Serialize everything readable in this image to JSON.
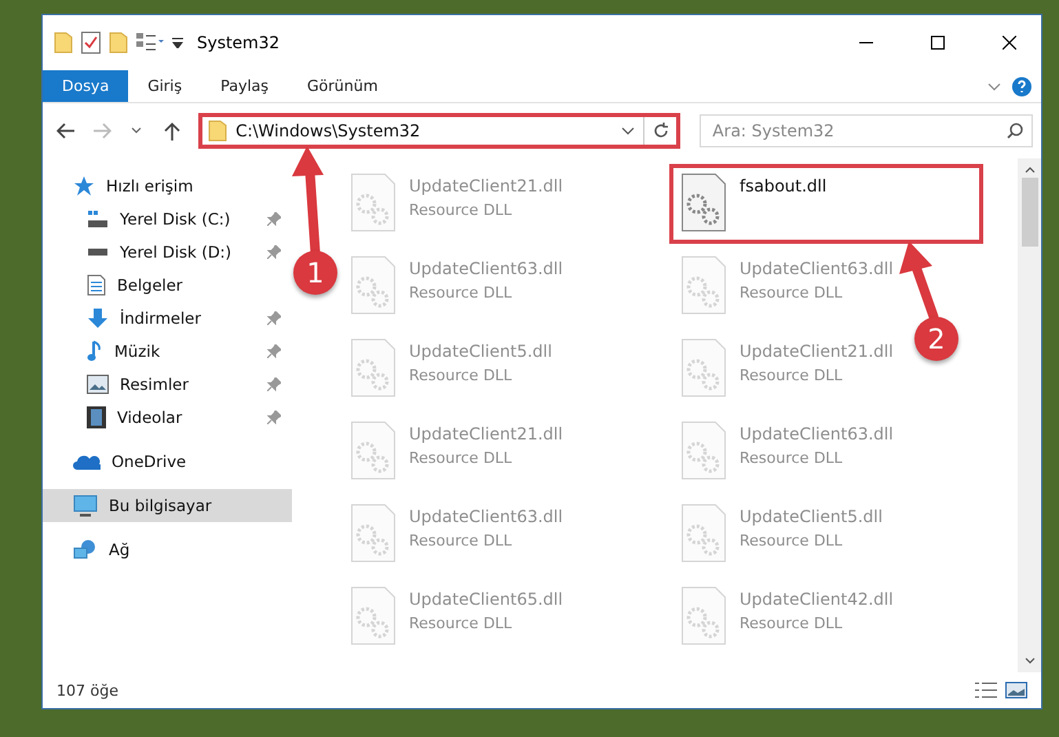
{
  "window": {
    "title": "System32"
  },
  "ribbon_tabs": [
    {
      "label": "Dosya",
      "selected": true
    },
    {
      "label": "Giriş",
      "selected": false
    },
    {
      "label": "Paylaş",
      "selected": false
    },
    {
      "label": "Görünüm",
      "selected": false
    }
  ],
  "address": {
    "path": "C:\\Windows\\System32",
    "highlighted": true
  },
  "search": {
    "placeholder": "Ara: System32"
  },
  "sidebar": {
    "items": [
      {
        "label": "Hızlı erişim",
        "selected": false,
        "children": [
          {
            "label": "Yerel Disk (C:)",
            "selected": false,
            "pinned": true
          },
          {
            "label": "Yerel Disk (D:)",
            "selected": false,
            "pinned": true
          },
          {
            "label": "Belgeler",
            "selected": false,
            "pinned": false
          },
          {
            "label": "İndirmeler",
            "selected": false,
            "pinned": true
          },
          {
            "label": "Müzik",
            "selected": false,
            "pinned": true
          },
          {
            "label": "Resimler",
            "selected": false,
            "pinned": true
          },
          {
            "label": "Videolar",
            "selected": false,
            "pinned": true
          }
        ]
      },
      {
        "label": "OneDrive",
        "selected": false
      },
      {
        "label": "Bu bilgisayar",
        "selected": true
      },
      {
        "label": "Ağ",
        "selected": false
      }
    ]
  },
  "files": [
    {
      "name": "UpdateClient21.dll",
      "type": "Resource DLL",
      "faded": true,
      "highlighted": false
    },
    {
      "name": "fsabout.dll",
      "faded": false,
      "highlighted": true
    },
    {
      "name": "UpdateClient63.dll",
      "type": "Resource DLL",
      "faded": true,
      "highlighted": false
    },
    {
      "name": "UpdateClient63.dll",
      "type": "Resource DLL",
      "faded": true,
      "highlighted": false
    },
    {
      "name": "UpdateClient5.dll",
      "type": "Resource DLL",
      "faded": true,
      "highlighted": false
    },
    {
      "name": "UpdateClient21.dll",
      "type": "Resource DLL",
      "faded": true,
      "highlighted": false
    },
    {
      "name": "UpdateClient21.dll",
      "type": "Resource DLL",
      "faded": true,
      "highlighted": false
    },
    {
      "name": "UpdateClient63.dll",
      "type": "Resource DLL",
      "faded": true,
      "highlighted": false
    },
    {
      "name": "UpdateClient63.dll",
      "type": "Resource DLL",
      "faded": true,
      "highlighted": false
    },
    {
      "name": "UpdateClient5.dll",
      "type": "Resource DLL",
      "faded": true,
      "highlighted": false
    },
    {
      "name": "UpdateClient65.dll",
      "type": "Resource DLL",
      "faded": true,
      "highlighted": false
    },
    {
      "name": "UpdateClient42.dll",
      "type": "Resource DLL",
      "faded": true,
      "highlighted": false
    }
  ],
  "status_bar": {
    "count": "107 öğe"
  },
  "annotations": [
    {
      "number": "1"
    },
    {
      "number": "2"
    }
  ]
}
